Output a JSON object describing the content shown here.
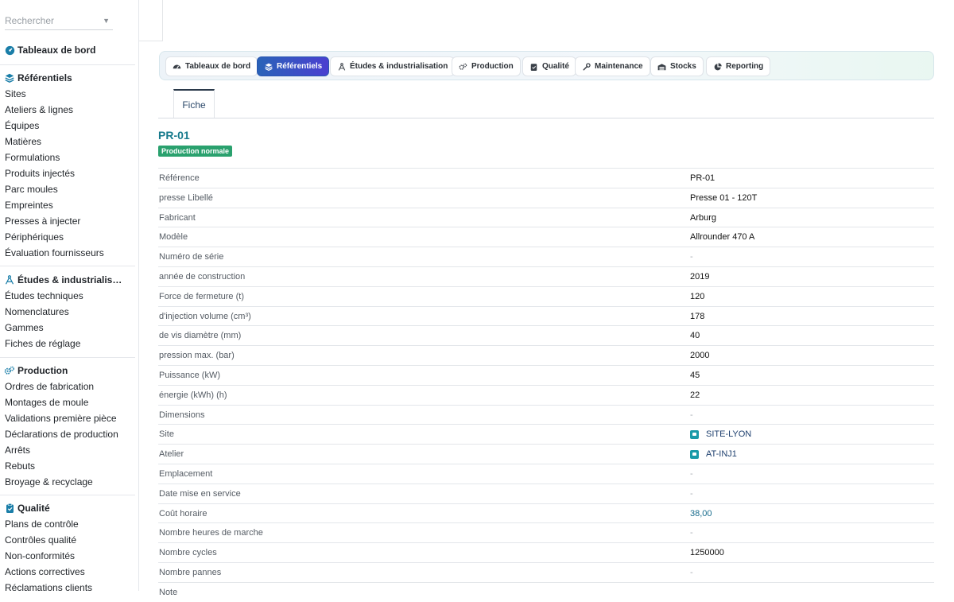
{
  "search": {
    "placeholder": "Rechercher"
  },
  "sidebar": {
    "dashboard": "Tableaux de bord",
    "sections": [
      {
        "title": "Référentiels",
        "icon": "layers-icon",
        "items": [
          "Sites",
          "Ateliers & lignes",
          "Équipes",
          "Matières",
          "Formulations",
          "Produits injectés",
          "Parc moules",
          "Empreintes",
          "Presses à injecter",
          "Périphériques",
          "Évaluation fournisseurs"
        ]
      },
      {
        "title": "Études & industrialis…",
        "icon": "compass-icon",
        "items": [
          "Études techniques",
          "Nomenclatures",
          "Gammes",
          "Fiches de réglage"
        ]
      },
      {
        "title": "Production",
        "icon": "gears-icon",
        "items": [
          "Ordres de fabrication",
          "Montages de moule",
          "Validations première pièce",
          "Déclarations de production",
          "Arrêts",
          "Rebuts",
          "Broyage & recyclage"
        ]
      },
      {
        "title": "Qualité",
        "icon": "clipboard-check-icon",
        "items": [
          "Plans de contrôle",
          "Contrôles qualité",
          "Non-conformités",
          "Actions correctives",
          "Réclamations clients"
        ]
      }
    ]
  },
  "tabs": [
    {
      "label": "Tableaux de bord",
      "icon": "dashboard-icon"
    },
    {
      "label": "Référentiels",
      "icon": "layers-icon",
      "active": true
    },
    {
      "label": "Études & industrialisation",
      "icon": "compass-icon"
    },
    {
      "label": "Production",
      "icon": "gears-icon"
    },
    {
      "label": "Qualité",
      "icon": "clipboard-check-icon"
    },
    {
      "label": "Maintenance",
      "icon": "wrench-icon"
    },
    {
      "label": "Stocks",
      "icon": "warehouse-icon"
    },
    {
      "label": "Reporting",
      "icon": "pie-chart-icon"
    }
  ],
  "subtab": "Fiche",
  "record": {
    "title": "PR-01",
    "status": "Production normale",
    "fields": [
      {
        "label": "Référence",
        "value": "PR-01"
      },
      {
        "label": "presse Libellé",
        "value": "Presse 01 - 120T"
      },
      {
        "label": "Fabricant",
        "value": "Arburg"
      },
      {
        "label": "Modèle",
        "value": "Allrounder 470 A"
      },
      {
        "label": "Numéro de série",
        "value": "-"
      },
      {
        "label": "année de construction",
        "value": "2019"
      },
      {
        "label": "Force de fermeture (t)",
        "value": "120"
      },
      {
        "label": "d'injection volume (cm³)",
        "value": "178"
      },
      {
        "label": "de vis diamètre (mm)",
        "value": "40"
      },
      {
        "label": "pression max. (bar)",
        "value": "2000"
      },
      {
        "label": "Puissance (kW)",
        "value": "45"
      },
      {
        "label": "énergie (kWh) (h)",
        "value": "22"
      },
      {
        "label": "Dimensions",
        "value": "-"
      },
      {
        "label": "Site",
        "value": "SITE-LYON"
      },
      {
        "label": "Atelier",
        "value": "AT-INJ1"
      },
      {
        "label": "Emplacement",
        "value": "-"
      },
      {
        "label": "Date mise en service",
        "value": "-"
      },
      {
        "label": "Coût horaire",
        "value": "38,00"
      },
      {
        "label": "Nombre heures de marche",
        "value": "-"
      },
      {
        "label": "Nombre cycles",
        "value": "1250000"
      },
      {
        "label": "Nombre pannes",
        "value": "-"
      },
      {
        "label": "Note",
        "value": ""
      }
    ]
  },
  "colors": {
    "accent": "#177a8c",
    "active_tab": "#2f5fb8",
    "badge": "#2aa16e"
  }
}
